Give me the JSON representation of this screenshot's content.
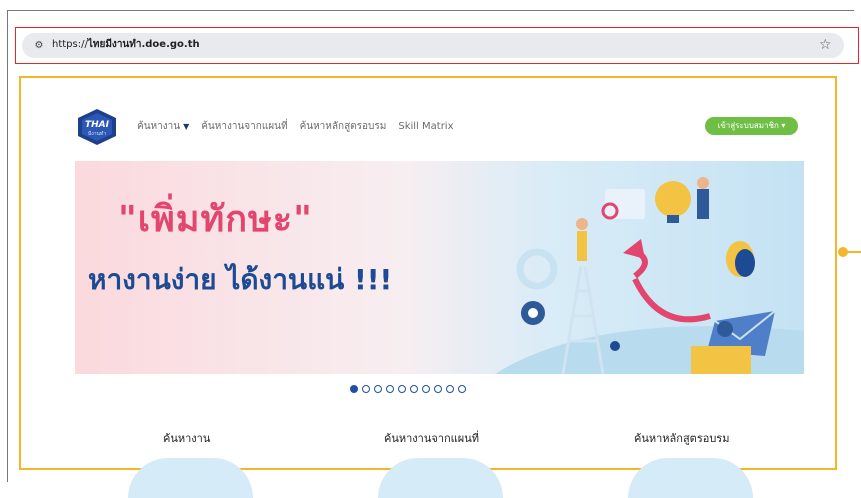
{
  "browser": {
    "url_prefix": "https://",
    "url_host": "ไทยมีงานทำ.doe.go.th",
    "site_icon": "tune-icon",
    "bookmark_icon": "star-icon"
  },
  "site": {
    "logo_text": "THAI",
    "logo_subtext": "มีงานทำ"
  },
  "nav": {
    "items": [
      "ค้นหางาน",
      "ค้นหางานจากแผนที่",
      "ค้นหาหลักสูตรอบรม",
      "Skill Matrix"
    ],
    "member_button": "เข้าสู่ระบบสมาชิก"
  },
  "banner": {
    "headline_line1": "\"เพิ่มทักษะ\"",
    "headline_line2": "หางานง่าย ได้งานแน่ !!!",
    "slide_count": 10,
    "active_slide": 1
  },
  "categories": [
    "ค้นหางาน",
    "ค้นหางานจากแผนที่",
    "ค้นหาหลักสูตรอบรม"
  ],
  "colors": {
    "accent_green": "#6fbf44",
    "headline_pink": "#e2456d",
    "headline_blue": "#1c4a93",
    "annotation_red": "#e0292a",
    "annotation_yellow": "#f2b62a"
  }
}
